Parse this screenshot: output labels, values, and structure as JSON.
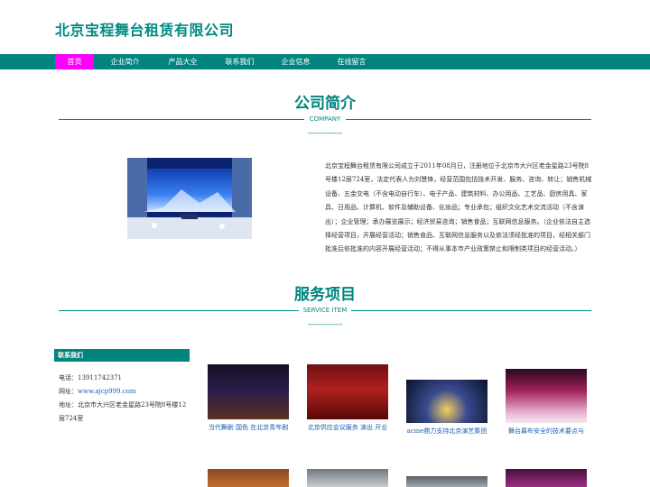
{
  "site": {
    "title": "北京宝程舞台租赁有限公司"
  },
  "nav": [
    {
      "label": "首页",
      "active": true
    },
    {
      "label": "企业简介"
    },
    {
      "label": "产品大全"
    },
    {
      "label": "联系我们"
    },
    {
      "label": "企业信息"
    },
    {
      "label": "在线留言"
    }
  ],
  "company": {
    "title": "公司简介",
    "subtitle": "COMPANY",
    "dashes": "----------------",
    "description": "北京宝程舞台租赁有限公司成立于2011年08月日，注册地位于北京市大兴区老金星路23号院8号楼12层724室，法定代表人为刘慧锋，经营范围包括技术开发、服务、咨询、转让；销售机械设备、五金交电（不含电动自行车）、电子产品、建筑材料、办公用品、工艺品、厨房用具、家具、日用品、计算机、软件及辅助设备、化妆品；专业承包；组织文化艺术交流活动（不含演出）；企业管理；承办展览展示；经济贸易咨询；销售食品；互联网信息服务。（企业依法自主选择经营项目，开展经营活动；销售食品、互联网信息服务以及依法须经批准的项目，经相关部门批准后依批准的内容开展经营活动；不得从事本市产业政策禁止和限制类项目的经营活动。）"
  },
  "services": {
    "title": "服务项目",
    "subtitle": "SERVICE ITEM",
    "dashes": "----------------"
  },
  "sidebar": {
    "heading": "联系我们",
    "phone_label": "电话：",
    "phone": "13911742371",
    "site_label": "网址：",
    "site": "www.ajcp999.com",
    "address_label": "地址：",
    "address_line1": "北京市大兴区老金星路23号院8号楼12",
    "address_line2": "层724室"
  },
  "products": [
    {
      "caption": "当代舞剧 国色 在北京青年剧",
      "colors": [
        "#1a1030",
        "#3b2450",
        "#6a3a2a"
      ]
    },
    {
      "caption": "北京供应会议服务 演出 开业",
      "colors": [
        "#5a0a0a",
        "#a01818",
        "#d24040"
      ]
    },
    {
      "caption": "acme鼎力支持北京演艺集团",
      "colors": [
        "#0a1228",
        "#1e2a58",
        "#f2d060"
      ]
    },
    {
      "caption": "舞台幕布安全的技术要点与",
      "colors": [
        "#3a0a2a",
        "#a0205a",
        "#e8a0c0"
      ]
    }
  ]
}
